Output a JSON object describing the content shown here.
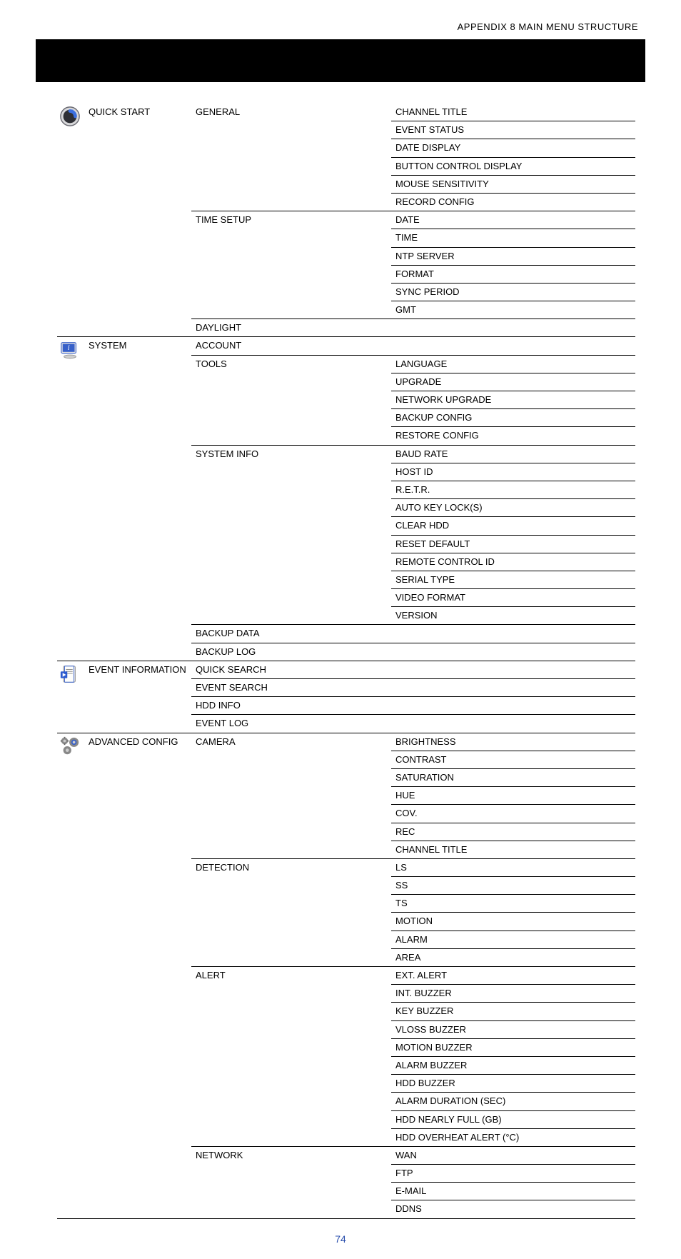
{
  "header": "APPENDIX 8 MAIN MENU STRUCTURE",
  "page_number": "74",
  "sections": [
    {
      "icon": "quickstart-icon",
      "title": "QUICK START",
      "subs": [
        {
          "title": "GENERAL",
          "leaves": [
            "CHANNEL TITLE",
            "EVENT STATUS",
            "DATE DISPLAY",
            "BUTTON CONTROL DISPLAY",
            "MOUSE SENSITIVITY",
            "RECORD CONFIG"
          ]
        },
        {
          "title": "TIME SETUP",
          "leaves": [
            "DATE",
            "TIME",
            "NTP SERVER",
            "FORMAT",
            "SYNC PERIOD",
            "GMT"
          ]
        },
        {
          "title": "DAYLIGHT",
          "leaves": [
            ""
          ]
        }
      ]
    },
    {
      "icon": "system-icon",
      "title": "SYSTEM",
      "subs": [
        {
          "title": "ACCOUNT",
          "leaves": [
            ""
          ]
        },
        {
          "title": "TOOLS",
          "leaves": [
            "LANGUAGE",
            "UPGRADE",
            "NETWORK UPGRADE",
            "BACKUP CONFIG",
            "RESTORE CONFIG"
          ]
        },
        {
          "title": "SYSTEM INFO",
          "leaves": [
            "BAUD RATE",
            "HOST ID",
            "R.E.T.R.",
            "AUTO KEY LOCK(S)",
            "CLEAR HDD",
            "RESET DEFAULT",
            "REMOTE CONTROL ID",
            "SERIAL TYPE",
            "VIDEO FORMAT",
            "VERSION"
          ]
        },
        {
          "title": "BACKUP DATA",
          "leaves": [
            ""
          ]
        },
        {
          "title": "BACKUP LOG",
          "leaves": [
            ""
          ]
        }
      ]
    },
    {
      "icon": "eventinfo-icon",
      "title": "EVENT INFORMATION",
      "subs": [
        {
          "title": "QUICK SEARCH",
          "leaves": [
            ""
          ]
        },
        {
          "title": "EVENT SEARCH",
          "leaves": [
            ""
          ]
        },
        {
          "title": "HDD INFO",
          "leaves": [
            ""
          ]
        },
        {
          "title": "EVENT LOG",
          "leaves": [
            ""
          ]
        }
      ]
    },
    {
      "icon": "advanced-icon",
      "title": "ADVANCED CONFIG",
      "subs": [
        {
          "title": "CAMERA",
          "leaves": [
            "BRIGHTNESS",
            "CONTRAST",
            "SATURATION",
            "HUE",
            "COV.",
            "REC",
            "CHANNEL TITLE"
          ]
        },
        {
          "title": "DETECTION",
          "leaves": [
            "LS",
            "SS",
            "TS",
            "MOTION",
            "ALARM",
            "AREA"
          ]
        },
        {
          "title": "ALERT",
          "leaves": [
            "EXT. ALERT",
            "INT. BUZZER",
            "KEY BUZZER",
            "VLOSS BUZZER",
            "MOTION BUZZER",
            "ALARM BUZZER",
            "HDD BUZZER",
            "ALARM DURATION (SEC)",
            "HDD NEARLY FULL (GB)",
            "HDD OVERHEAT ALERT (°C)"
          ]
        },
        {
          "title": "NETWORK",
          "leaves": [
            "WAN",
            "FTP",
            "E-MAIL",
            "DDNS"
          ]
        }
      ]
    }
  ]
}
